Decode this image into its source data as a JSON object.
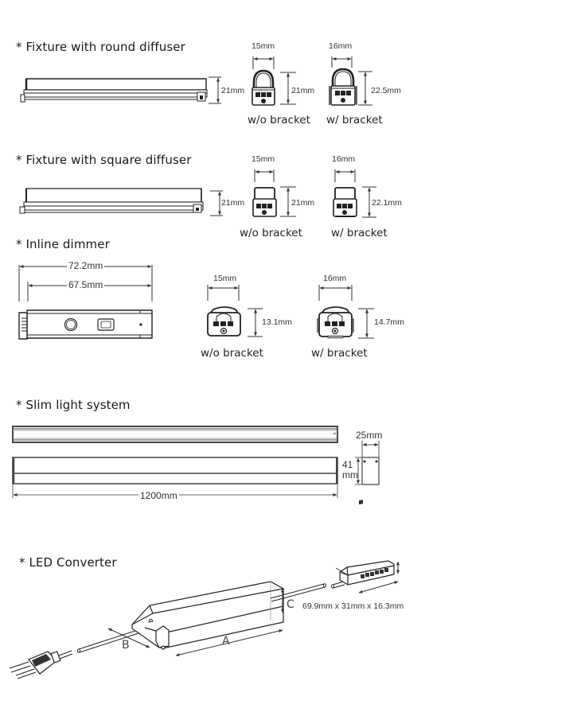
{
  "sections": {
    "round": {
      "title": "* Fixture with round diffuser",
      "side_height": "21mm",
      "wo": {
        "width": "15mm",
        "height": "21mm",
        "label": "w/o bracket"
      },
      "w": {
        "width": "16mm",
        "height": "22.5mm",
        "label": "w/ bracket"
      }
    },
    "square": {
      "title": "* Fixture with square diffuser",
      "side_height": "21mm",
      "wo": {
        "width": "15mm",
        "height": "21mm",
        "label": "w/o bracket"
      },
      "w": {
        "width": "16mm",
        "height": "22.1mm",
        "label": "w/ bracket"
      }
    },
    "dimmer": {
      "title": "* Inline dimmer",
      "overall_length": "72.2mm",
      "body_length": "67.5mm",
      "wo": {
        "width": "15mm",
        "height": "13.1mm",
        "label": "w/o bracket"
      },
      "w": {
        "width": "16mm",
        "height": "14.7mm",
        "label": "w/ bracket"
      }
    },
    "slim": {
      "title": "* Slim light system",
      "length": "1200mm",
      "width": "25mm",
      "height_line1": "41",
      "height_line2": "mm"
    },
    "converter": {
      "title": "* LED Converter",
      "label_a": "A",
      "label_b": "B",
      "label_c": "C",
      "junction_dims": "69.9mm x 31mm x 16.3mm"
    }
  }
}
